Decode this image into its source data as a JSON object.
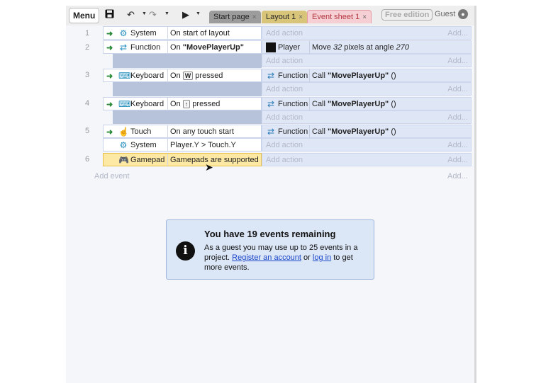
{
  "toolbar": {
    "menu_label": "Menu",
    "tabs": [
      {
        "label": "Start page",
        "close": "×"
      },
      {
        "label": "Layout 1",
        "close": "×"
      },
      {
        "label": "Event sheet 1",
        "close": "×"
      }
    ],
    "edition_badge": "Free edition",
    "user_label": "Guest",
    "icons": [
      "save-icon",
      "undo-icon",
      "redo-icon",
      "play-icon",
      "user-icon"
    ]
  },
  "events": [
    {
      "number": "1",
      "conditions": [
        {
          "object": "System",
          "icon": "gear-icon",
          "text": "On start of layout"
        }
      ],
      "actions": [],
      "add_action": "Add action",
      "add_right": "Add..."
    },
    {
      "number": "2",
      "conditions": [
        {
          "object": "Function",
          "icon": "function-icon",
          "text_prefix": "On ",
          "text_bold": "\"MovePlayerUp\""
        }
      ],
      "actions": [
        {
          "object": "Player",
          "icon": "player-swatch",
          "text_prefix": "Move ",
          "text_italic": "32",
          "text_mid": " pixels at angle ",
          "text_italic2": "270"
        }
      ],
      "add_action": "Add action",
      "add_right": "Add..."
    },
    {
      "number": "3",
      "conditions": [
        {
          "object": "Keyboard",
          "icon": "keyboard-icon",
          "text_prefix": "On ",
          "key": "W",
          "text_suffix": " pressed"
        }
      ],
      "actions": [
        {
          "object": "Function",
          "icon": "function-icon",
          "text_prefix": "Call ",
          "text_bold": "\"MovePlayerUp\"",
          "text_suffix": " ()"
        }
      ],
      "add_action": "Add action",
      "add_right": "Add..."
    },
    {
      "number": "4",
      "conditions": [
        {
          "object": "Keyboard",
          "icon": "keyboard-icon",
          "text_prefix": "On ",
          "key": "↑",
          "text_suffix": " pressed"
        }
      ],
      "actions": [
        {
          "object": "Function",
          "icon": "function-icon",
          "text_prefix": "Call ",
          "text_bold": "\"MovePlayerUp\"",
          "text_suffix": " ()"
        }
      ],
      "add_action": "Add action",
      "add_right": "Add..."
    },
    {
      "number": "5",
      "conditions": [
        {
          "object": "Touch",
          "icon": "touch-icon",
          "text": "On any touch start"
        },
        {
          "object": "System",
          "icon": "gear-icon",
          "text": "Player.Y > Touch.Y"
        }
      ],
      "actions": [
        {
          "object": "Function",
          "icon": "function-icon",
          "text_prefix": "Call ",
          "text_bold": "\"MovePlayerUp\"",
          "text_suffix": " ()"
        }
      ],
      "add_action": "Add action",
      "add_right": "Add..."
    },
    {
      "number": "6",
      "conditions": [
        {
          "object": "Gamepad",
          "icon": "gamepad-icon",
          "text": "Gamepads are supported"
        }
      ],
      "actions": [],
      "add_action": "Add action",
      "add_right": "Add..."
    }
  ],
  "add_event": {
    "label": "Add event",
    "right": "Add..."
  },
  "notice": {
    "title": "You have 19 events remaining",
    "body_1": "As a guest you may use up to 25 events in a project. ",
    "link_register": "Register an account",
    "body_2": " or ",
    "link_login": "log in",
    "body_3": " to get more events.",
    "icon": "info-icon"
  }
}
